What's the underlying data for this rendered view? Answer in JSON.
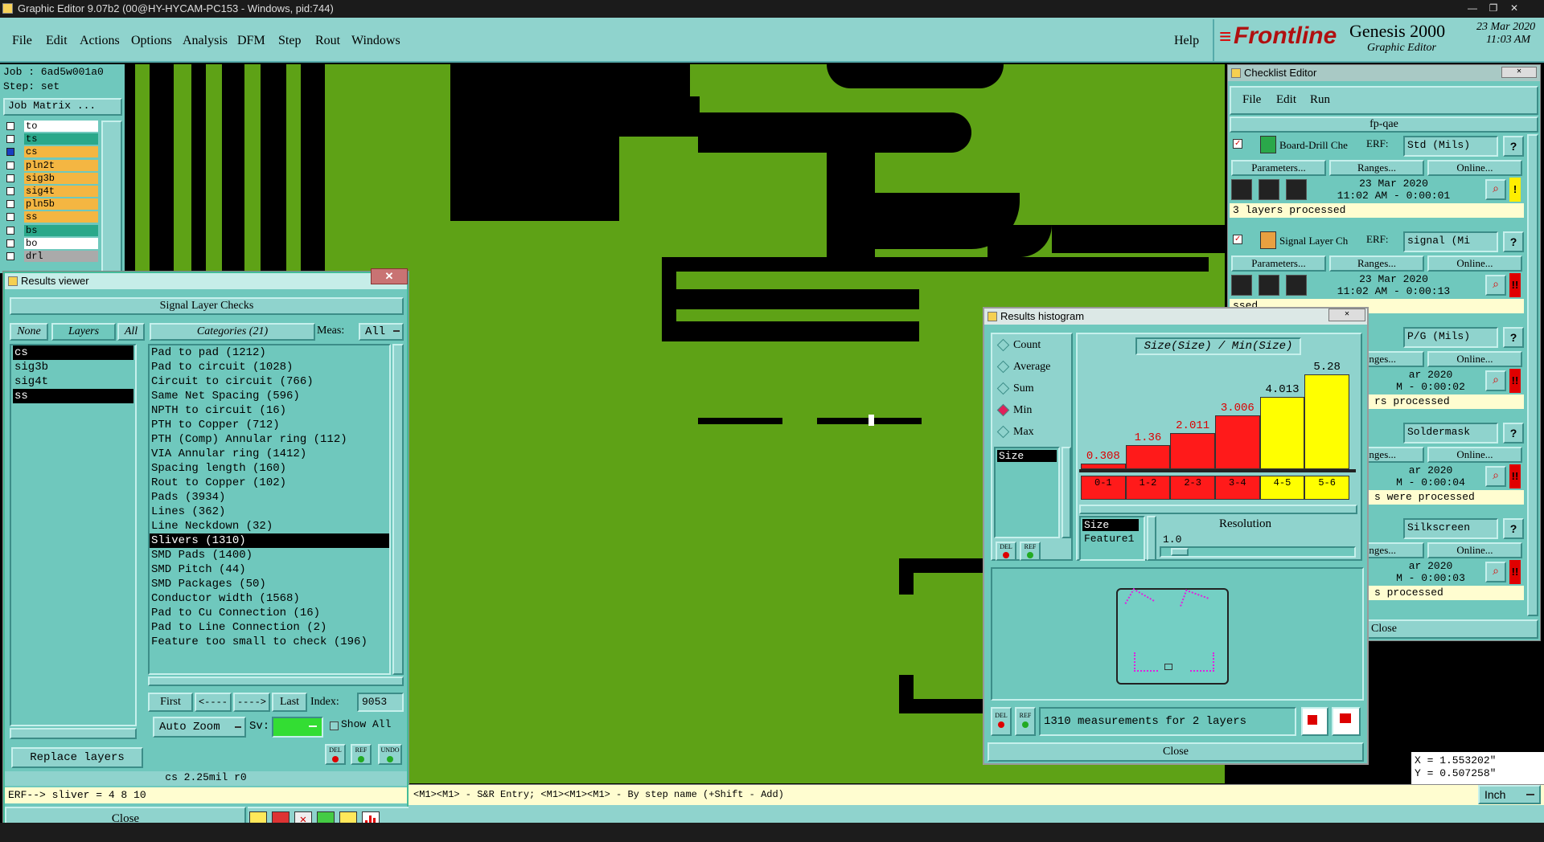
{
  "window_title": "Graphic Editor 9.07b2 (00@HY-HYCAM-PC153 - Windows, pid:744)",
  "menu": [
    "File",
    "Edit",
    "Actions",
    "Options",
    "Analysis",
    "DFM",
    "Step",
    "Rout",
    "Windows"
  ],
  "help": "Help",
  "brand": {
    "logo": "Frontline",
    "product": "Genesis 2000",
    "subtitle": "Graphic Editor",
    "date": "23 Mar 2020",
    "time": "11:03 AM"
  },
  "job": {
    "job": "Job : 6ad5w001a0",
    "step": "Step: set",
    "matrix_btn": "Job Matrix ..."
  },
  "layers": [
    {
      "name": "to",
      "color": "#ffffff"
    },
    {
      "name": "ts",
      "color": "#2aa88a"
    },
    {
      "name": "cs",
      "color": "#f4b642"
    },
    {
      "name": "pln2t",
      "color": "#f4b642"
    },
    {
      "name": "sig3b",
      "color": "#f4b642"
    },
    {
      "name": "sig4t",
      "color": "#f4b642"
    },
    {
      "name": "pln5b",
      "color": "#f4b642"
    },
    {
      "name": "ss",
      "color": "#f4b642"
    },
    {
      "name": "bs",
      "color": "#2aa88a"
    },
    {
      "name": "bo",
      "color": "#ffffff"
    },
    {
      "name": "drl",
      "color": "#aaaaaa"
    }
  ],
  "results_viewer": {
    "title": "Results viewer",
    "heading": "Signal Layer Checks",
    "btn_none": "None",
    "btn_layers": "Layers",
    "btn_all": "All",
    "categories_label": "Categories (21)",
    "meas_label": "Meas:",
    "meas_value": "All",
    "layer_list": [
      "cs",
      "sig3b",
      "sig4t",
      "ss"
    ],
    "categories": [
      "Pad to pad (1212)",
      "Pad to circuit (1028)",
      "Circuit to circuit (766)",
      "Same Net Spacing (596)",
      "NPTH to circuit (16)",
      "PTH to Copper (712)",
      "PTH (Comp) Annular ring (112)",
      "VIA Annular ring (1412)",
      "Spacing length (160)",
      "Rout to Copper (102)",
      "Pads (3934)",
      "Lines (362)",
      "Line Neckdown (32)",
      "Slivers (1310)",
      "SMD Pads (1400)",
      "SMD Pitch (44)",
      "SMD Packages (50)",
      "Conductor width (1568)",
      "Pad to Cu Connection (16)",
      "Pad to Line Connection (2)",
      "Feature too small to check (196)"
    ],
    "nav": {
      "first": "First",
      "prev": "<----",
      "next": "---->",
      "last": "Last",
      "index_label": "Index:",
      "index_value": "9053"
    },
    "auto_zoom": "Auto Zoom",
    "sv": "Sv:",
    "show_all": "Show All",
    "replace_layers": "Replace layers",
    "status": "cs 2.25mil  r0",
    "erf_line": "ERF--> sliver = 4 8 10",
    "close": "Close",
    "small_btns": [
      "DEL",
      "REF",
      "UNDO"
    ]
  },
  "status_msg": "<M1><M1> - S&R Entry; <M1><M1><M1> - By step name (+Shift - Add)",
  "units": "Inch",
  "coords": {
    "x": "X = 1.553202\"",
    "y": "Y = 0.507258\""
  },
  "checklist": {
    "title": "Checklist Editor",
    "menu": [
      "File",
      "Edit",
      "Run"
    ],
    "name": "fp-qae",
    "erf": "ERF:",
    "params": "Parameters...",
    "ranges": "Ranges...",
    "online": "Online...",
    "items": [
      {
        "label": "Board-Drill Che",
        "erf_value": "Std (Mils)",
        "date": "23 Mar 2020",
        "time": "11:02 AM - 0:00:01",
        "note": "3 layers processed",
        "flag": "!",
        "flag_color": "#ffee00"
      },
      {
        "label": "Signal Layer Ch",
        "erf_value": "signal (Mi",
        "date": "23 Mar 2020",
        "time": "11:02 AM - 0:00:13",
        "note": "ssed",
        "flag": "!!",
        "flag_color": "#e00000"
      },
      {
        "label": "",
        "erf_value": "P/G (Mils)",
        "date": "ar 2020",
        "time": "M - 0:00:02",
        "note": "rs processed",
        "flag": "!!",
        "flag_color": "#e00000"
      },
      {
        "label": "",
        "erf_value": "Soldermask",
        "date": "ar 2020",
        "time": "M - 0:00:04",
        "note": "s were processed",
        "flag": "!!",
        "flag_color": "#e00000"
      },
      {
        "label": "",
        "erf_value": "Silkscreen",
        "date": "ar 2020",
        "time": "M - 0:00:03",
        "note": "s processed",
        "flag": "!!",
        "flag_color": "#e00000"
      }
    ],
    "close": "Close"
  },
  "histogram": {
    "title": "Results histogram",
    "modes": [
      "Count",
      "Average",
      "Sum",
      "Min",
      "Max"
    ],
    "selected_mode": "Min",
    "attr_list": [
      "Size"
    ],
    "chart_title": "Size(Size) / Min(Size)",
    "x_attr_list": [
      "Size",
      "Feature1"
    ],
    "resolution_label": "Resolution",
    "resolution_value": "1.0",
    "summary": "1310 measurements for 2 layers",
    "close": "Close",
    "small_btns": [
      "DEL",
      "REF"
    ]
  },
  "chart_data": {
    "type": "bar",
    "title": "Size(Size) / Min(Size)",
    "categories": [
      "0-1",
      "1-2",
      "2-3",
      "3-4",
      "4-5",
      "5-6"
    ],
    "values": [
      0.308,
      1.36,
      2.011,
      3.006,
      4.013,
      5.28
    ],
    "value_labels": [
      "0.308",
      "1.36",
      "2.011",
      "3.006",
      "4.013",
      "5.28"
    ],
    "colors": [
      "#ff1a1a",
      "#ff1a1a",
      "#ff1a1a",
      "#ff1a1a",
      "#ffff00",
      "#ffff00"
    ],
    "ylim": [
      0,
      5.28
    ]
  }
}
